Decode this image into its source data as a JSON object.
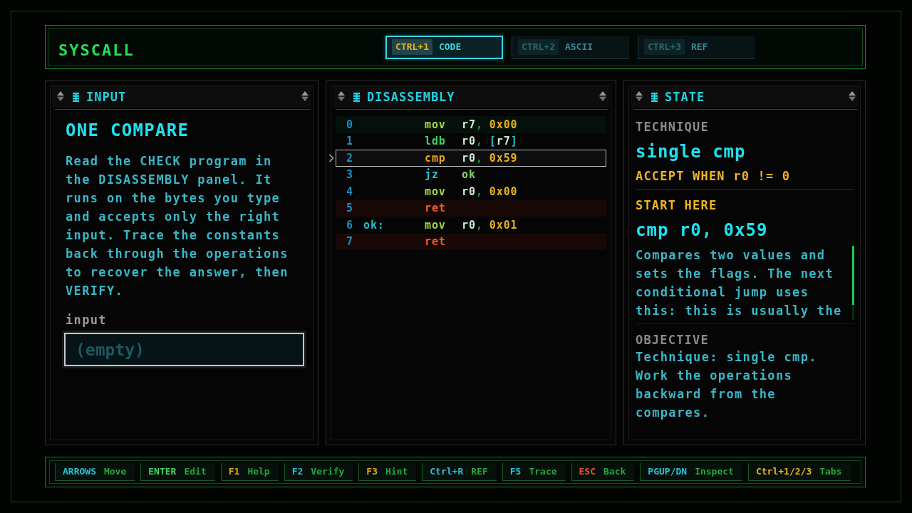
{
  "app": {
    "title": "SYSCALL"
  },
  "tabs": [
    {
      "key": "CTRL+1",
      "label": "CODE",
      "selected": true
    },
    {
      "key": "CTRL+2",
      "label": "ASCII",
      "selected": false
    },
    {
      "key": "CTRL+3",
      "label": "REF",
      "selected": false
    }
  ],
  "input_panel": {
    "title": "INPUT",
    "heading": "ONE COMPARE",
    "description": "Read the CHECK program in the DISASSEMBLY panel. It runs on the bytes you type and accepts only the right input. Trace the constants back through the operations to recover the answer, then VERIFY.",
    "field_label": "input",
    "field": {
      "placeholder": "(empty)"
    }
  },
  "disassembly_panel": {
    "title": "DISASSEMBLY",
    "rows": [
      {
        "index": "0",
        "mnemonic": "mov",
        "color": "#a4d83c",
        "kind": "entry",
        "selected": false,
        "operands": [
          {
            "text": "r7",
            "kind": "register"
          },
          {
            "text": ",",
            "kind": "separator"
          },
          {
            "text": "0x00",
            "kind": "immediate"
          }
        ]
      },
      {
        "index": "1",
        "mnemonic": "ldb",
        "color": "#3ed462",
        "kind": "plain",
        "selected": false,
        "operands": [
          {
            "text": "r0",
            "kind": "register"
          },
          {
            "text": ",",
            "kind": "separator"
          },
          {
            "text": "[",
            "kind": "bracket"
          },
          {
            "text": "r7",
            "kind": "register"
          },
          {
            "text": "]",
            "kind": "bracket"
          }
        ]
      },
      {
        "index": "2",
        "mnemonic": "cmp",
        "color": "#eca01e",
        "kind": "plain",
        "selected": true,
        "operands": [
          {
            "text": "r0",
            "kind": "register"
          },
          {
            "text": ",",
            "kind": "separator"
          },
          {
            "text": "0x59",
            "kind": "immediate"
          }
        ]
      },
      {
        "index": "3",
        "mnemonic": "jz",
        "color": "#22c8dc",
        "kind": "plain",
        "selected": false,
        "operands": [
          {
            "text": "ok",
            "kind": "target"
          }
        ]
      },
      {
        "index": "4",
        "mnemonic": "mov",
        "color": "#a4d83c",
        "kind": "plain",
        "selected": false,
        "operands": [
          {
            "text": "r0",
            "kind": "register"
          },
          {
            "text": ",",
            "kind": "separator"
          },
          {
            "text": "0x00",
            "kind": "immediate"
          }
        ]
      },
      {
        "index": "5",
        "mnemonic": "ret",
        "color": "#f05a2a",
        "kind": "exit",
        "selected": false
      },
      {
        "index": "6",
        "label": "ok:",
        "mnemonic": "mov",
        "color": "#a4d83c",
        "kind": "plain",
        "selected": false,
        "operands": [
          {
            "text": "r0",
            "kind": "register"
          },
          {
            "text": ",",
            "kind": "separator"
          },
          {
            "text": "0x01",
            "kind": "immediate"
          }
        ]
      },
      {
        "index": "7",
        "mnemonic": "ret",
        "color": "#f05a2a",
        "kind": "exit",
        "selected": false
      }
    ]
  },
  "state_panel": {
    "title": "STATE",
    "technique_label": "TECHNIQUE",
    "technique": "single cmp",
    "accept_condition": "ACCEPT WHEN r0 != 0",
    "start_label": "START HERE",
    "start_instruction": "cmp r0, 0x59",
    "explanation": "Compares two values and sets the flags. The next conditional jump uses this: this is usually the",
    "objective_label": "OBJECTIVE",
    "objective": "Technique: single cmp. Work the operations backward from the compares."
  },
  "footer": {
    "hints": [
      {
        "key": "ARROWS",
        "action": "Move",
        "color": "#22c4dc"
      },
      {
        "key": "ENTER",
        "action": "Edit",
        "color": "#44d466"
      },
      {
        "key": "F1",
        "action": "Help",
        "color": "#e8a420"
      },
      {
        "key": "F2",
        "action": "Verify",
        "color": "#22c4dc"
      },
      {
        "key": "F3",
        "action": "Hint",
        "color": "#e8a420"
      },
      {
        "key": "Ctrl+R",
        "action": "REF",
        "color": "#22c4dc"
      },
      {
        "key": "F5",
        "action": "Trace",
        "color": "#22c4dc"
      },
      {
        "key": "ESC",
        "action": "Back",
        "color": "#e8582c"
      },
      {
        "key": "PGUP/DN",
        "action": "Inspect",
        "color": "#22c4dc"
      },
      {
        "key": "Ctrl+1/2/3",
        "action": "Tabs",
        "color": "#e8b420"
      }
    ]
  }
}
